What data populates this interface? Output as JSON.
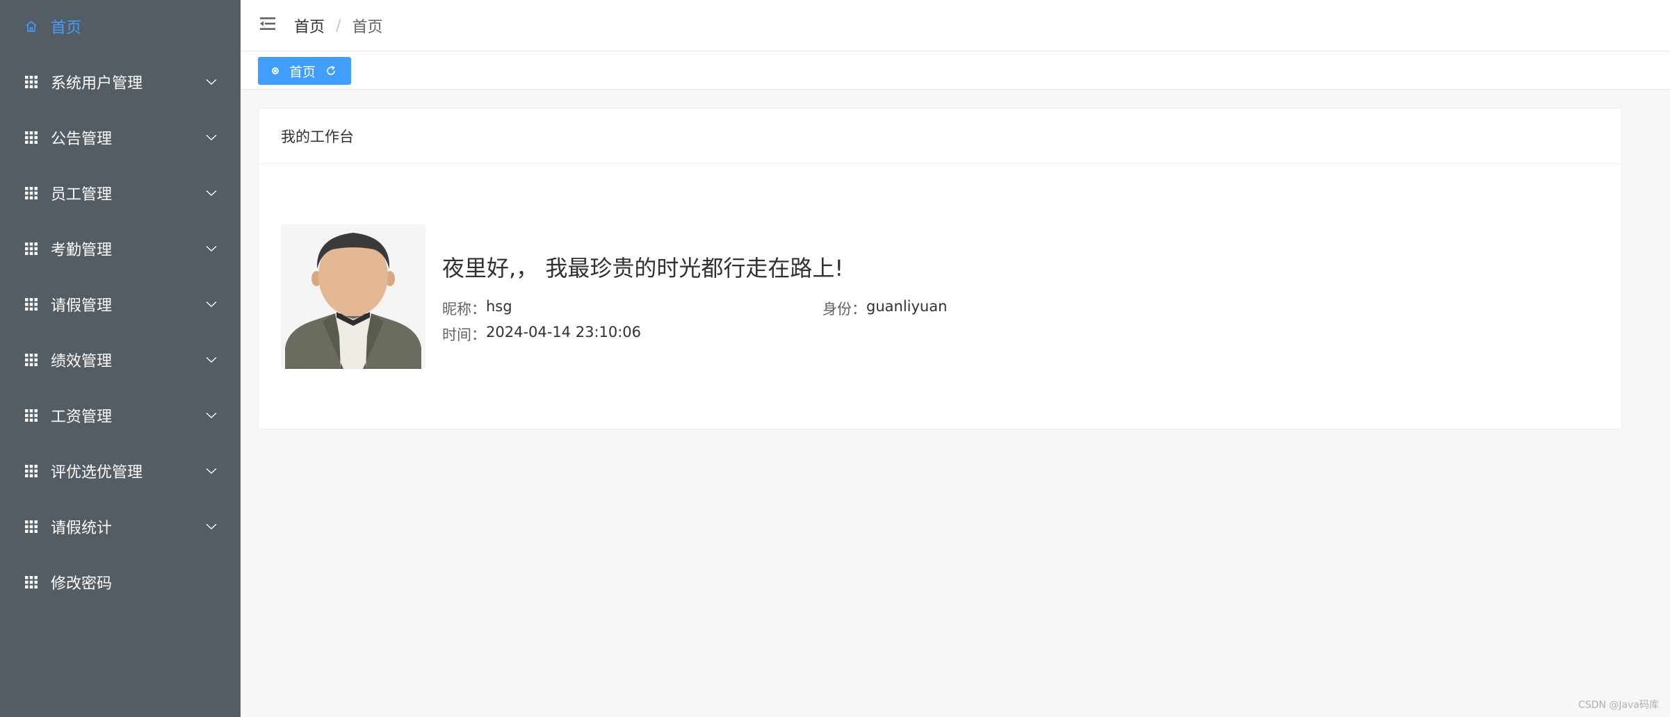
{
  "sidebar": {
    "items": [
      {
        "label": "首页",
        "icon": "home-icon",
        "active": true,
        "has_arrow": false
      },
      {
        "label": "系统用户管理",
        "icon": "grid-icon",
        "has_arrow": true
      },
      {
        "label": "公告管理",
        "icon": "grid-icon",
        "has_arrow": true
      },
      {
        "label": "员工管理",
        "icon": "grid-icon",
        "has_arrow": true
      },
      {
        "label": "考勤管理",
        "icon": "grid-icon",
        "has_arrow": true
      },
      {
        "label": "请假管理",
        "icon": "grid-icon",
        "has_arrow": true
      },
      {
        "label": "绩效管理",
        "icon": "grid-icon",
        "has_arrow": true
      },
      {
        "label": "工资管理",
        "icon": "grid-icon",
        "has_arrow": true
      },
      {
        "label": "评优选优管理",
        "icon": "grid-icon",
        "has_arrow": true
      },
      {
        "label": "请假统计",
        "icon": "grid-icon",
        "has_arrow": true
      },
      {
        "label": "修改密码",
        "icon": "grid-icon",
        "has_arrow": false
      }
    ]
  },
  "header": {
    "breadcrumb": [
      "首页",
      "首页"
    ],
    "separator": "/"
  },
  "tags": {
    "active_tag": "首页"
  },
  "card": {
    "title": "我的工作台",
    "greeting": "夜里好,， 我最珍贵的时光都行走在路上!",
    "nickname_label": "昵称：",
    "nickname": "hsg",
    "role_label": "身份：",
    "role": "guanliyuan",
    "time_label": "时间：",
    "time": "2024-04-14 23:10:06"
  },
  "watermark": "CSDN @Java码库",
  "colors": {
    "sidebar_bg": "#545c64",
    "accent": "#409eff",
    "page_bg": "#f7f7f7"
  }
}
